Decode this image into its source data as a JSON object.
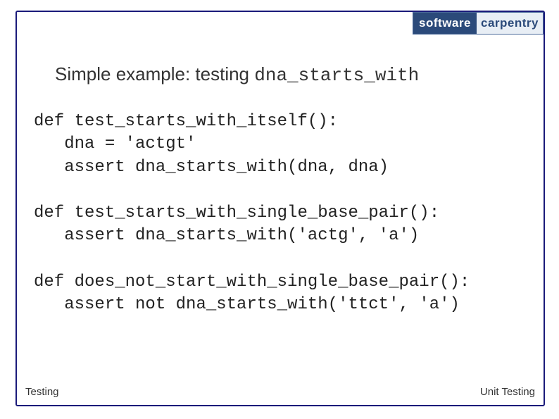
{
  "logo": {
    "left": "software",
    "right": "carpentry"
  },
  "title": {
    "prefix": "Simple example: testing ",
    "code": "dna_starts_with"
  },
  "code": {
    "block1": "def test_starts_with_itself():\n   dna = 'actgt'\n   assert dna_starts_with(dna, dna)",
    "block2": "def test_starts_with_single_base_pair():\n   assert dna_starts_with('actg', 'a')",
    "block3": "def does_not_start_with_single_base_pair():\n   assert not dna_starts_with('ttct', 'a')"
  },
  "footer": {
    "left": "Testing",
    "right": "Unit Testing"
  }
}
